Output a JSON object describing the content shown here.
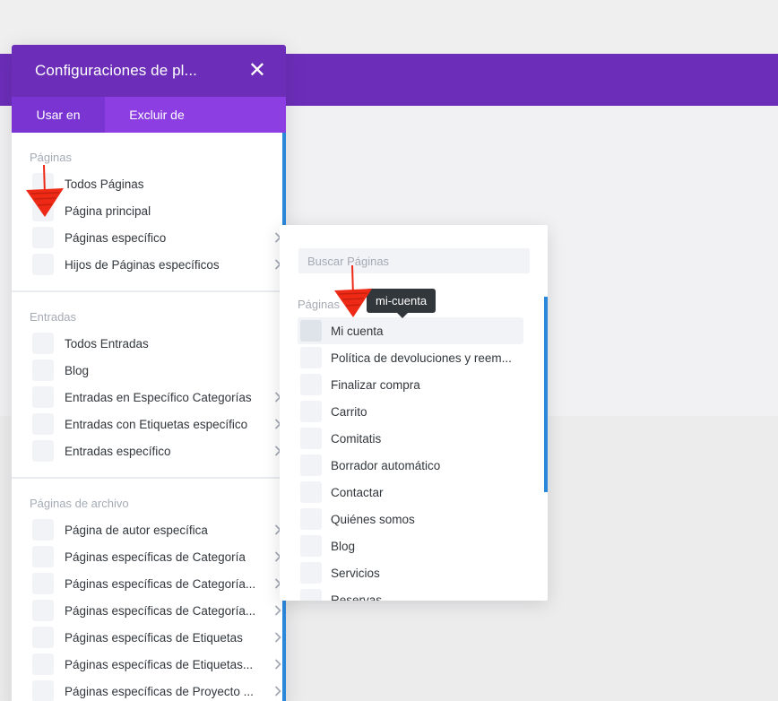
{
  "panel": {
    "title": "Configuraciones de pl...",
    "tabs": [
      {
        "label": "Usar en",
        "active": true
      },
      {
        "label": "Excluir de",
        "active": false
      }
    ]
  },
  "sections": [
    {
      "title": "Páginas",
      "items": [
        {
          "label": "Todos Páginas",
          "has_submenu": false
        },
        {
          "label": "Página principal",
          "has_submenu": false
        },
        {
          "label": "Páginas específico",
          "has_submenu": true
        },
        {
          "label": "Hijos de Páginas específicos",
          "has_submenu": true
        }
      ]
    },
    {
      "title": "Entradas",
      "items": [
        {
          "label": "Todos Entradas",
          "has_submenu": false
        },
        {
          "label": "Blog",
          "has_submenu": false
        },
        {
          "label": "Entradas en Específico Categorías",
          "has_submenu": true
        },
        {
          "label": "Entradas con Etiquetas específico",
          "has_submenu": true
        },
        {
          "label": "Entradas específico",
          "has_submenu": true
        }
      ]
    },
    {
      "title": "Páginas de archivo",
      "items": [
        {
          "label": "Página de autor específica",
          "has_submenu": true
        },
        {
          "label": "Páginas específicas de Categoría",
          "has_submenu": true
        },
        {
          "label": "Páginas específicas de Categoría...",
          "has_submenu": true
        },
        {
          "label": "Páginas específicas de Categoría...",
          "has_submenu": true
        },
        {
          "label": "Páginas específicas de Etiquetas",
          "has_submenu": true
        },
        {
          "label": "Páginas específicas de Etiquetas...",
          "has_submenu": true
        },
        {
          "label": "Páginas específicas de Proyecto ...",
          "has_submenu": true
        }
      ]
    }
  ],
  "submenu": {
    "search_placeholder": "Buscar Páginas",
    "title": "Páginas",
    "items": [
      {
        "label": "Mi cuenta",
        "highlighted": true
      },
      {
        "label": "Política de devoluciones y reem...",
        "highlighted": false
      },
      {
        "label": "Finalizar compra",
        "highlighted": false
      },
      {
        "label": "Carrito",
        "highlighted": false
      },
      {
        "label": "Comitatis",
        "highlighted": false
      },
      {
        "label": "Borrador automático",
        "highlighted": false
      },
      {
        "label": "Contactar",
        "highlighted": false
      },
      {
        "label": "Quiénes somos",
        "highlighted": false
      },
      {
        "label": "Blog",
        "highlighted": false
      },
      {
        "label": "Servicios",
        "highlighted": false
      },
      {
        "label": "Reservas",
        "highlighted": false
      }
    ]
  },
  "tooltip": {
    "text": "mi-cuenta"
  },
  "colors": {
    "brand_purple": "#6c2eb9",
    "tab_purple": "#8c3ee2",
    "accent_blue": "#2b87da",
    "annotation_red": "#ee2a16"
  },
  "icons": {
    "close": "close-icon",
    "chevron": "chevron-right-icon",
    "annotation": "red-arrow-annotation"
  }
}
